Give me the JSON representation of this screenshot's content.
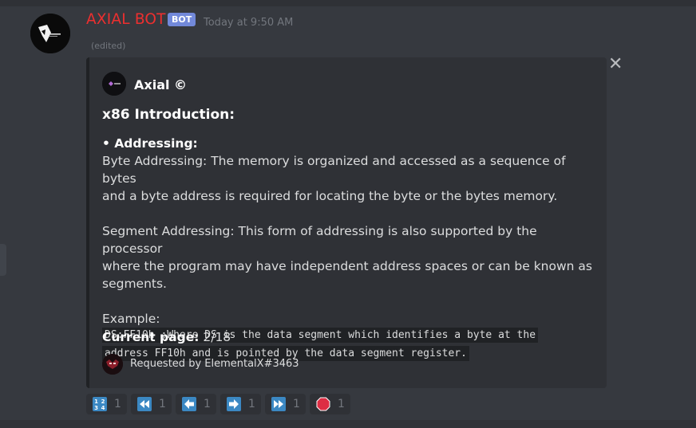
{
  "message": {
    "username": "AXIAL BOT",
    "bot_tag": "BOT",
    "timestamp": "Today at 9:50 AM",
    "edited": "(edited)"
  },
  "embed": {
    "author": "Axial ©",
    "title": "x86 Introduction:",
    "section_heading": "• Addressing:",
    "paragraph1_line1": "Byte Addressing: The memory is organized and accessed as a sequence of bytes",
    "paragraph1_line2": "and a byte address is required for locating the byte or the bytes memory.",
    "paragraph2_line1": "Segment Addressing: This form of addressing is also supported by the processor",
    "paragraph2_line2": "where the program may have independent address spaces or can be known as",
    "paragraph2_line3": "segments.",
    "example_label": "Example:",
    "code_line1": "DS:FF10h ;Where DS is the data segment which identifies a byte at the",
    "code_line2": "address FF10h and is pointed by the data segment register.",
    "field_label": "Current page:",
    "field_value": "2/18",
    "footer": "Requested by ElementalX#3463"
  },
  "reactions": [
    {
      "icon": "numbers-1234-icon",
      "count": "1"
    },
    {
      "icon": "rewind-icon",
      "count": "1"
    },
    {
      "icon": "arrow-left-icon",
      "count": "1"
    },
    {
      "icon": "arrow-right-icon",
      "count": "1"
    },
    {
      "icon": "fast-forward-icon",
      "count": "1"
    },
    {
      "icon": "stop-sign-icon",
      "count": "1"
    }
  ],
  "colors": {
    "background": "#36393f",
    "embed_bg": "#2f3136",
    "username": "#ed2f2f",
    "bot_tag": "#7289da",
    "emoji_blue": "#3b88c3",
    "stop_red": "#dd2e44"
  }
}
